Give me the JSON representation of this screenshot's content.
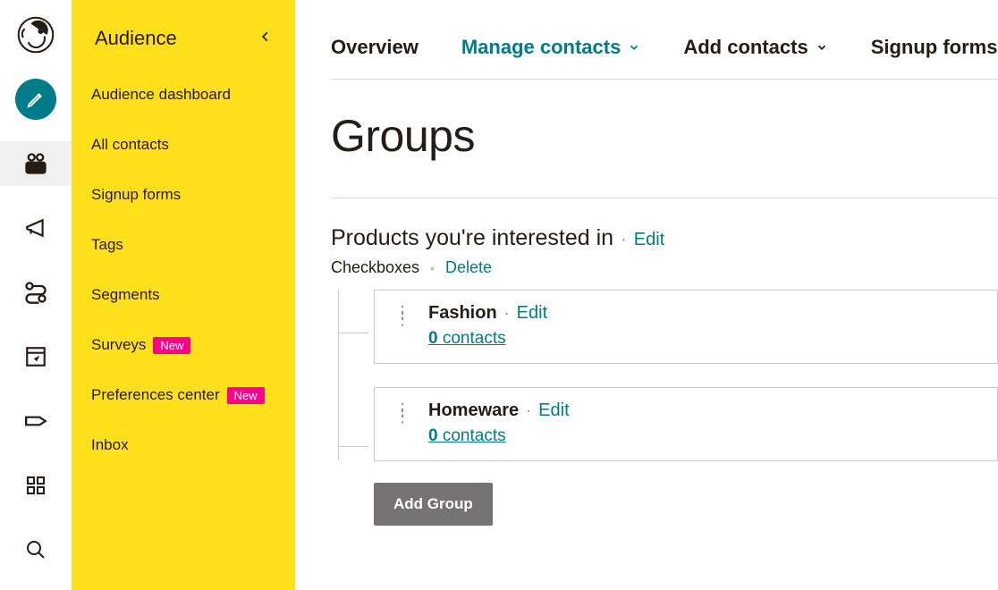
{
  "sidebar": {
    "title": "Audience",
    "items": [
      {
        "label": "Audience dashboard",
        "badge": null
      },
      {
        "label": "All contacts",
        "badge": null
      },
      {
        "label": "Signup forms",
        "badge": null
      },
      {
        "label": "Tags",
        "badge": null
      },
      {
        "label": "Segments",
        "badge": null
      },
      {
        "label": "Surveys",
        "badge": "New"
      },
      {
        "label": "Preferences center",
        "badge": "New"
      },
      {
        "label": "Inbox",
        "badge": null
      }
    ]
  },
  "tabs": {
    "overview": "Overview",
    "manage": "Manage contacts",
    "add": "Add contacts",
    "signup": "Signup forms"
  },
  "page_title": "Groups",
  "category": {
    "title": "Products you're interested in",
    "edit": "Edit",
    "type": "Checkboxes",
    "delete": "Delete"
  },
  "groups": [
    {
      "name": "Fashion",
      "edit": "Edit",
      "contacts_count": "0",
      "contacts_label": "contacts"
    },
    {
      "name": "Homeware",
      "edit": "Edit",
      "contacts_count": "0",
      "contacts_label": "contacts"
    }
  ],
  "add_group_label": "Add Group",
  "badge_text": "New"
}
